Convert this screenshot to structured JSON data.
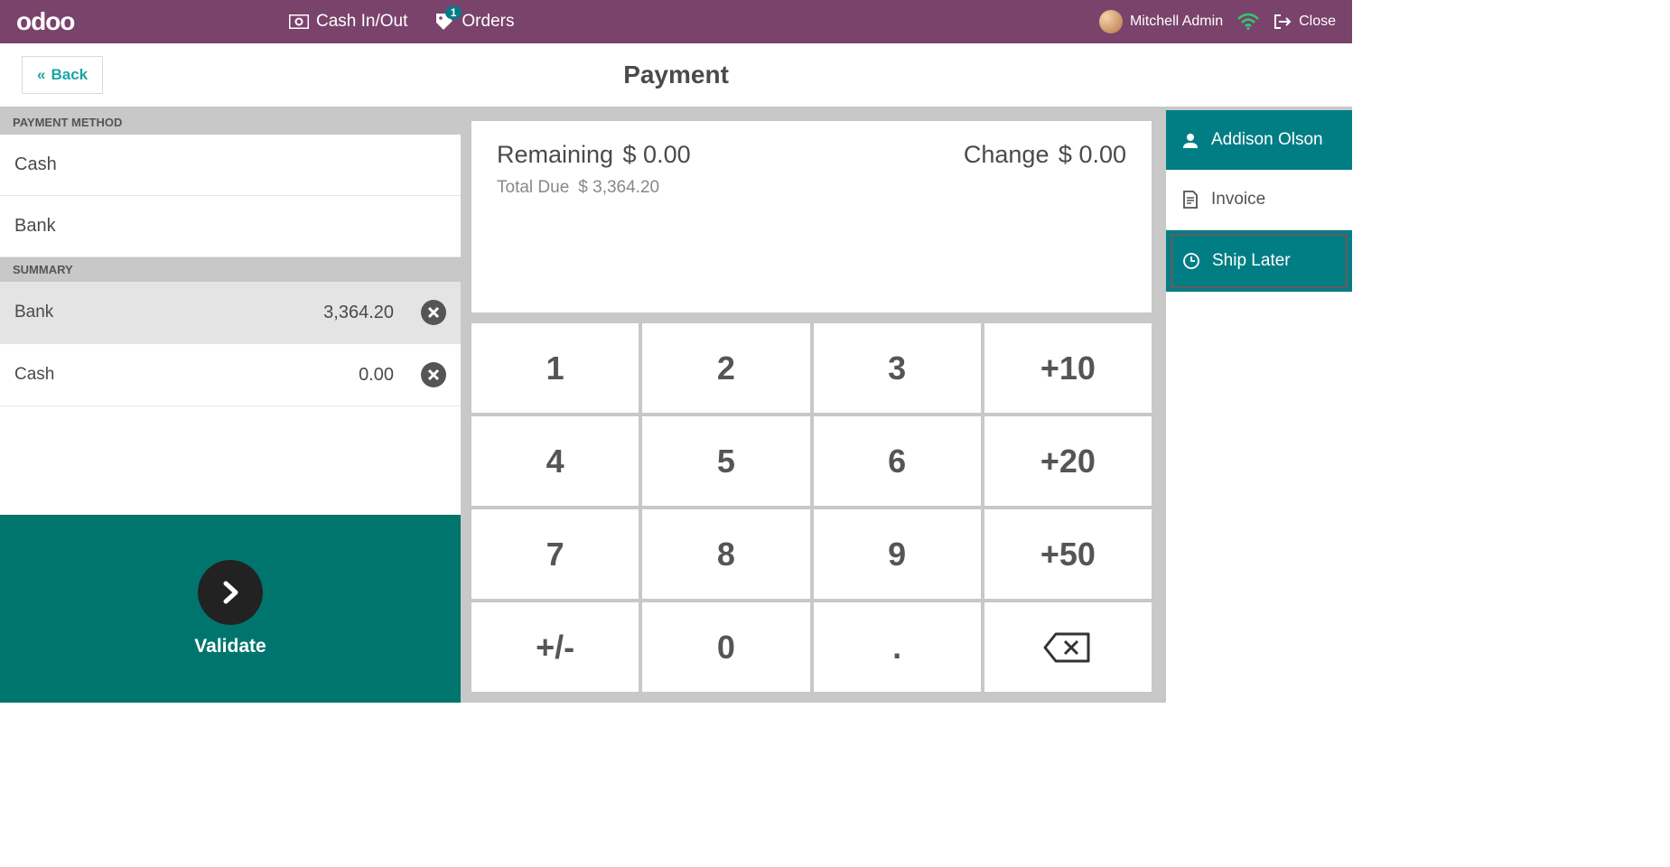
{
  "header": {
    "brand": "odoo",
    "cash_in_out": "Cash In/Out",
    "orders": "Orders",
    "orders_badge": "1",
    "user_name": "Mitchell Admin",
    "close": "Close"
  },
  "subheader": {
    "back": "Back",
    "title": "Payment"
  },
  "payment_methods": {
    "header": "PAYMENT METHOD",
    "cash": "Cash",
    "bank": "Bank"
  },
  "summary": {
    "header": "SUMMARY",
    "rows": [
      {
        "label": "Bank",
        "amount": "3,364.20"
      },
      {
        "label": "Cash",
        "amount": "0.00"
      }
    ]
  },
  "validate": {
    "label": "Validate"
  },
  "status": {
    "remaining_label": "Remaining",
    "remaining_value": "$ 0.00",
    "change_label": "Change",
    "change_value": "$ 0.00",
    "totaldue_label": "Total Due",
    "totaldue_value": "$ 3,364.20"
  },
  "numpad": {
    "k1": "1",
    "k2": "2",
    "k3": "3",
    "p10": "+10",
    "k4": "4",
    "k5": "5",
    "k6": "6",
    "p20": "+20",
    "k7": "7",
    "k8": "8",
    "k9": "9",
    "p50": "+50",
    "pm": "+/-",
    "k0": "0",
    "dot": "."
  },
  "right": {
    "customer": "Addison Olson",
    "invoice": "Invoice",
    "ship_later": "Ship Later"
  }
}
